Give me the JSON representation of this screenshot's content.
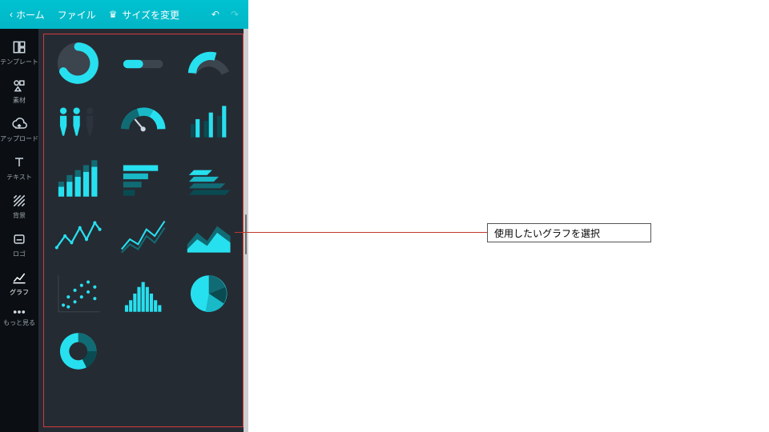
{
  "topbar": {
    "back_icon": "‹",
    "home": "ホーム",
    "file": "ファイル",
    "resize": "サイズを変更",
    "undo": "↶",
    "redo": "↷"
  },
  "rail": [
    {
      "key": "template",
      "label": "テンプレート"
    },
    {
      "key": "elements",
      "label": "素材"
    },
    {
      "key": "upload",
      "label": "アップロード"
    },
    {
      "key": "text",
      "label": "テキスト"
    },
    {
      "key": "bg",
      "label": "背景"
    },
    {
      "key": "logo",
      "label": "ロゴ"
    },
    {
      "key": "graph",
      "label": "グラフ"
    },
    {
      "key": "more",
      "label": "もっと見る"
    }
  ],
  "callout": "使用したいグラフを選択",
  "thumbs": [
    "progress-ring",
    "progress-bar",
    "half-gauge",
    "people-pictogram",
    "gauge-dial",
    "grouped-bars",
    "stacked-bars",
    "h-bars",
    "layered-bars-3d",
    "line-chart",
    "multi-line",
    "area-chart",
    "scatter",
    "histogram",
    "pie",
    "donut"
  ]
}
